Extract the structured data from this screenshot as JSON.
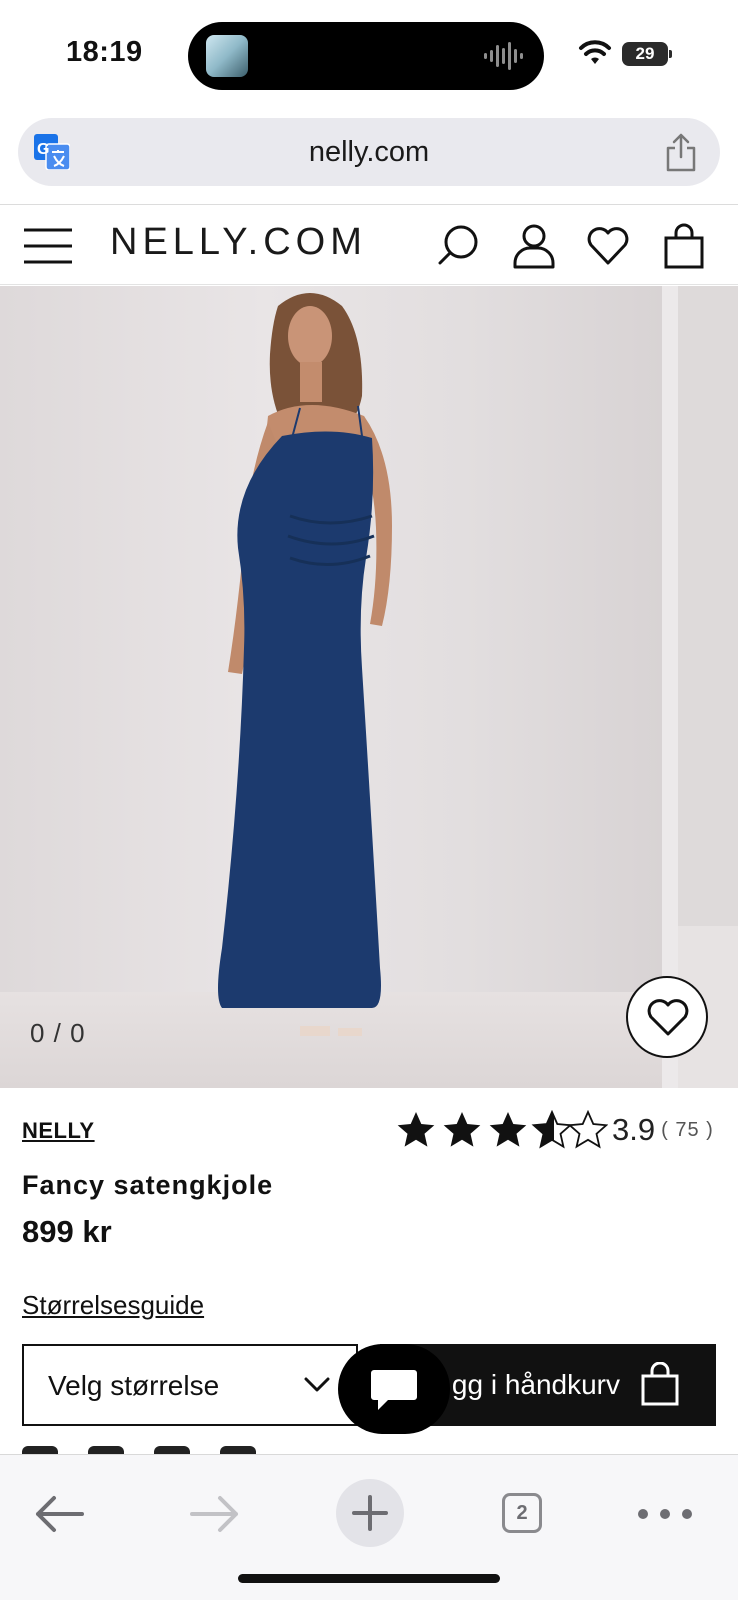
{
  "status_bar": {
    "time": "18:19",
    "battery": "29"
  },
  "browser": {
    "url": "nelly.com",
    "tab_count": "2"
  },
  "site": {
    "logo": "NELLY.COM"
  },
  "gallery": {
    "counter": "0 / 0"
  },
  "product": {
    "brand": "NELLY",
    "name": "Fancy satengkjole",
    "price": "899 kr",
    "rating": "3.9",
    "rating_stars_fraction": 0.78,
    "review_count": "( 75 )",
    "size_guide": "Størrelsesguide",
    "size_select_label": "Velg størrelse",
    "add_to_cart_label": "gg i håndkurv"
  },
  "colors": {
    "dress": "#1c3a6e",
    "ink": "#111111",
    "toolbar_bg": "#f7f7f9",
    "url_bar_bg": "#e9e9ee"
  }
}
